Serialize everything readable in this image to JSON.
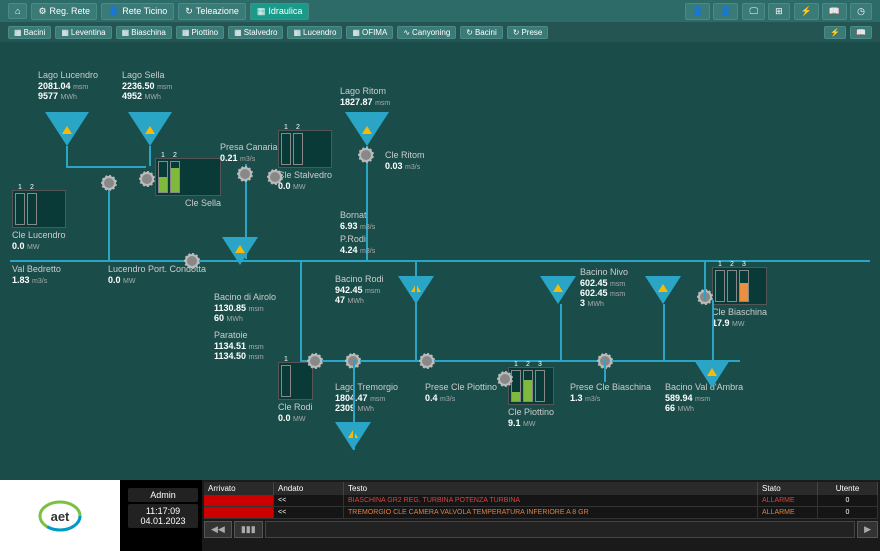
{
  "toolbar": {
    "reg_rete": "Reg. Rete",
    "rete_ticino": "Rete Ticino",
    "teleazione": "Teleazione",
    "idraulica": "Idraulica"
  },
  "toolbar2": {
    "bacini": "Bacini",
    "leventina": "Leventina",
    "biaschina": "Biaschina",
    "piottino": "Piottino",
    "stalvedro": "Stalvedro",
    "lucendro": "Lucendro",
    "ofima": "OFIMA",
    "canyoning": "Canyoning",
    "bacini2": "Bacini",
    "prese": "Prese"
  },
  "diagram_data": {
    "lago_lucendro": {
      "title": "Lago Lucendro",
      "level": "2081.04",
      "level_u": "msm",
      "energy": "9577",
      "energy_u": "MWh"
    },
    "lago_sella": {
      "title": "Lago Sella",
      "level": "2236.50",
      "level_u": "msm",
      "energy": "4952",
      "energy_u": "MWh"
    },
    "lago_ritom": {
      "title": "Lago Ritom",
      "level": "1827.87",
      "level_u": "msm"
    },
    "cle_sella": {
      "title": "Cle Sella"
    },
    "presa_canaria": {
      "title": "Presa Canaria",
      "flow": "0.21",
      "flow_u": "m3/s"
    },
    "cle_stalvedro": {
      "title": "Cle Stalvedro",
      "power": "0.0",
      "power_u": "MW"
    },
    "cle_ritom": {
      "title": "Cle Ritom",
      "flow": "0.03",
      "flow_u": "m3/s"
    },
    "cle_lucendro": {
      "title": "Cle Lucendro",
      "power": "0.0",
      "power_u": "MW"
    },
    "val_bedretto": {
      "title": "Val Bedretto",
      "flow": "1.83",
      "flow_u": "m3/s"
    },
    "lucendro_port": {
      "title": "Lucendro Port. Condotta",
      "power": "0.0",
      "power_u": "MW"
    },
    "bornat": {
      "title": "Bornat",
      "flow": "6.93",
      "flow_u": "m3/s"
    },
    "prodi": {
      "title": "P.Rodi",
      "flow": "4.24",
      "flow_u": "m3/s"
    },
    "bacino_airolo": {
      "title": "Bacino di Airolo",
      "level": "1130.85",
      "level_u": "msm",
      "energy": "60",
      "energy_u": "MWh"
    },
    "paratoie": {
      "title": "Paratoie",
      "l1": "1134.51",
      "l1_u": "msm",
      "l2": "1134.50",
      "l2_u": "msm"
    },
    "bacino_rodi": {
      "title": "Bacino Rodi",
      "level": "942.45",
      "level_u": "msm",
      "energy": "47",
      "energy_u": "MWh"
    },
    "bacino_nivo": {
      "title": "Bacino Nivo",
      "l1": "602.45",
      "l1_u": "msm",
      "l2": "602.45",
      "l2_u": "msm",
      "energy": "3",
      "energy_u": "MWh"
    },
    "cle_biaschina": {
      "title": "Cle Biaschina",
      "power": "17.9",
      "power_u": "MW"
    },
    "cle_rodi": {
      "title": "Cle Rodi",
      "power": "0.0",
      "power_u": "MW"
    },
    "lago_tremorgio": {
      "title": "Lago Tremorgio",
      "level": "1804.47",
      "level_u": "msm",
      "energy": "2309",
      "energy_u": "MWh"
    },
    "prese_cle_piottino": {
      "title": "Prese Cle Piottino",
      "flow": "0.4",
      "flow_u": "m3/s"
    },
    "prese_cle_biaschina": {
      "title": "Prese Cle Biaschina",
      "flow": "1.3",
      "flow_u": "m3/s"
    },
    "bacino_val_ambra": {
      "title": "Bacino Val d'Ambra",
      "level": "589.94",
      "level_u": "msm",
      "energy": "66",
      "energy_u": "MWh"
    },
    "cle_piottino": {
      "title": "Cle Piottino",
      "power": "9.1",
      "power_u": "MW"
    },
    "bar_labels": {
      "n1": "1",
      "n2": "2",
      "n3": "3"
    }
  },
  "footer": {
    "admin": "Admin",
    "time": "11:17:09",
    "date": "04.01.2023",
    "hdr": {
      "arrivato": "Arrivato",
      "andato": "Andato",
      "testo": "Testo",
      "stato": "Stato",
      "utente": "Utente"
    },
    "rows": [
      {
        "andato": "<<",
        "testo": "BIASCHINA GR2 REG. TURBINA POTENZA TURBINA",
        "stato": "ALLARME",
        "utente": "0",
        "cls": "txt-red"
      },
      {
        "andato": "<<",
        "testo": "TREMORGIO CLE CAMERA VALVOLA TEMPERATURA INFERIORE A 8 GR",
        "stato": "ALLARME",
        "utente": "0",
        "cls": "txt-or"
      }
    ],
    "ctrls": {
      "back": "◀◀",
      "play": "▶",
      "bar": "▮▮▮"
    }
  }
}
